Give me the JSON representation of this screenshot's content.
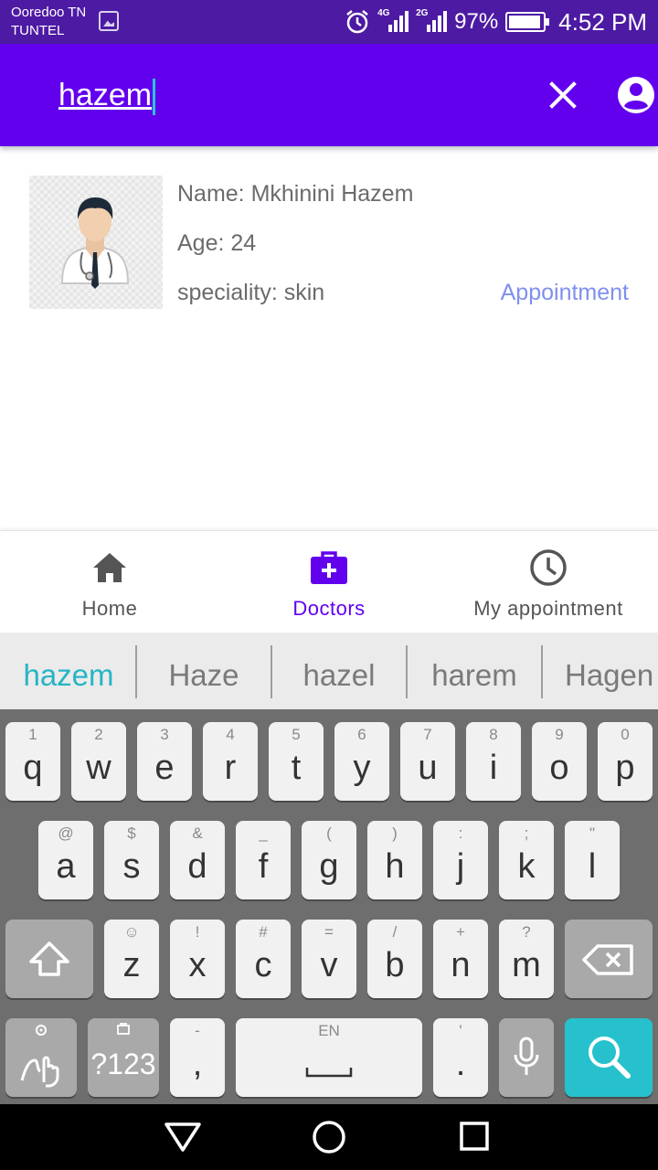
{
  "status_bar": {
    "carrier_line1": "Ooredoo TN",
    "carrier_line2": "TUNTEL",
    "network1": "4G",
    "network2": "2G",
    "battery": "97%",
    "time": "4:52 PM"
  },
  "toolbar": {
    "search_value": "hazem",
    "bg_color": "#6200ee"
  },
  "doctor": {
    "name": "Name: Mkhinini Hazem",
    "age": "Age: 24",
    "speciality": "speciality: skin",
    "appointment_label": "Appointment"
  },
  "bottom_nav": {
    "items": [
      {
        "label": "Home",
        "icon": "home-icon"
      },
      {
        "label": "Doctors",
        "icon": "medical-bag-icon",
        "active": true
      },
      {
        "label": "My appointment",
        "icon": "clock-icon"
      }
    ],
    "active_color": "#6200ee"
  },
  "keyboard": {
    "suggestions": [
      "hazem",
      "Haze",
      "hazel",
      "harem",
      "Hagen"
    ],
    "row1": [
      {
        "hint": "1",
        "key": "q"
      },
      {
        "hint": "2",
        "key": "w"
      },
      {
        "hint": "3",
        "key": "e"
      },
      {
        "hint": "4",
        "key": "r"
      },
      {
        "hint": "5",
        "key": "t"
      },
      {
        "hint": "6",
        "key": "y"
      },
      {
        "hint": "7",
        "key": "u"
      },
      {
        "hint": "8",
        "key": "i"
      },
      {
        "hint": "9",
        "key": "o"
      },
      {
        "hint": "0",
        "key": "p"
      }
    ],
    "row2": [
      {
        "hint": "@",
        "key": "a"
      },
      {
        "hint": "$",
        "key": "s"
      },
      {
        "hint": "&",
        "key": "d"
      },
      {
        "hint": "_",
        "key": "f"
      },
      {
        "hint": "(",
        "key": "g"
      },
      {
        "hint": ")",
        "key": "h"
      },
      {
        "hint": ":",
        "key": "j"
      },
      {
        "hint": ";",
        "key": "k"
      },
      {
        "hint": "\"",
        "key": "l"
      }
    ],
    "row3": [
      {
        "hint": "☺",
        "key": "z"
      },
      {
        "hint": "!",
        "key": "x"
      },
      {
        "hint": "#",
        "key": "c"
      },
      {
        "hint": "=",
        "key": "v"
      },
      {
        "hint": "/",
        "key": "b"
      },
      {
        "hint": "+",
        "key": "n"
      },
      {
        "hint": "?",
        "key": "m"
      }
    ],
    "symbols_key": "?123",
    "comma_hint": "-",
    "comma_key": ",",
    "space_hint": "EN",
    "period_hint": "'",
    "period_key": ".",
    "accent_color": "#26c1cc"
  }
}
